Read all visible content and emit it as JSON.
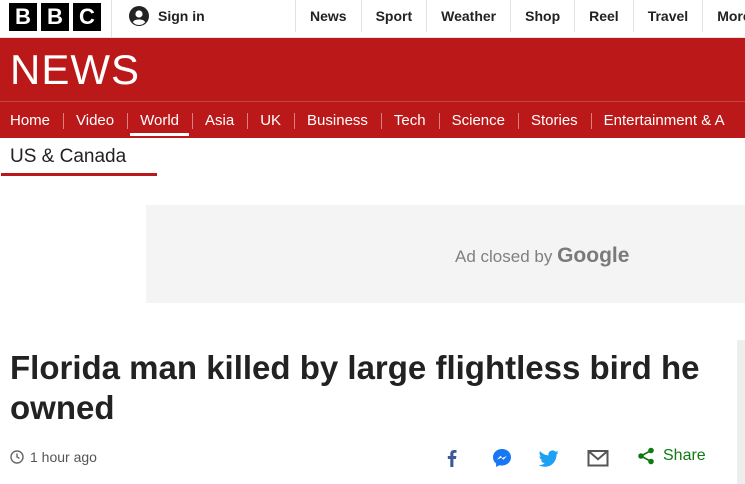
{
  "brand": {
    "letters": [
      "B",
      "B",
      "C"
    ],
    "news_title": "NEWS",
    "color": "#bb1919"
  },
  "account": {
    "sign_in_label": "Sign in",
    "icon": "user-icon"
  },
  "top_nav": {
    "items": [
      "News",
      "Sport",
      "Weather",
      "Shop",
      "Reel",
      "Travel",
      "More"
    ]
  },
  "section_nav": {
    "items": [
      "Home",
      "Video",
      "World",
      "Asia",
      "UK",
      "Business",
      "Tech",
      "Science",
      "Stories",
      "Entertainment & A"
    ],
    "active": "World"
  },
  "subsection": {
    "title": "US & Canada"
  },
  "ad": {
    "closed_text": "Ad closed by",
    "provider": "Google"
  },
  "article": {
    "headline": "Florida man killed by large flightless bird he owned",
    "timestamp": "1 hour ago",
    "timestamp_icon": "clock-icon"
  },
  "share": {
    "icons": [
      "facebook-icon",
      "messenger-icon",
      "twitter-icon",
      "email-icon",
      "share-icon"
    ],
    "label": "Share",
    "label_color": "#0f7a12"
  }
}
